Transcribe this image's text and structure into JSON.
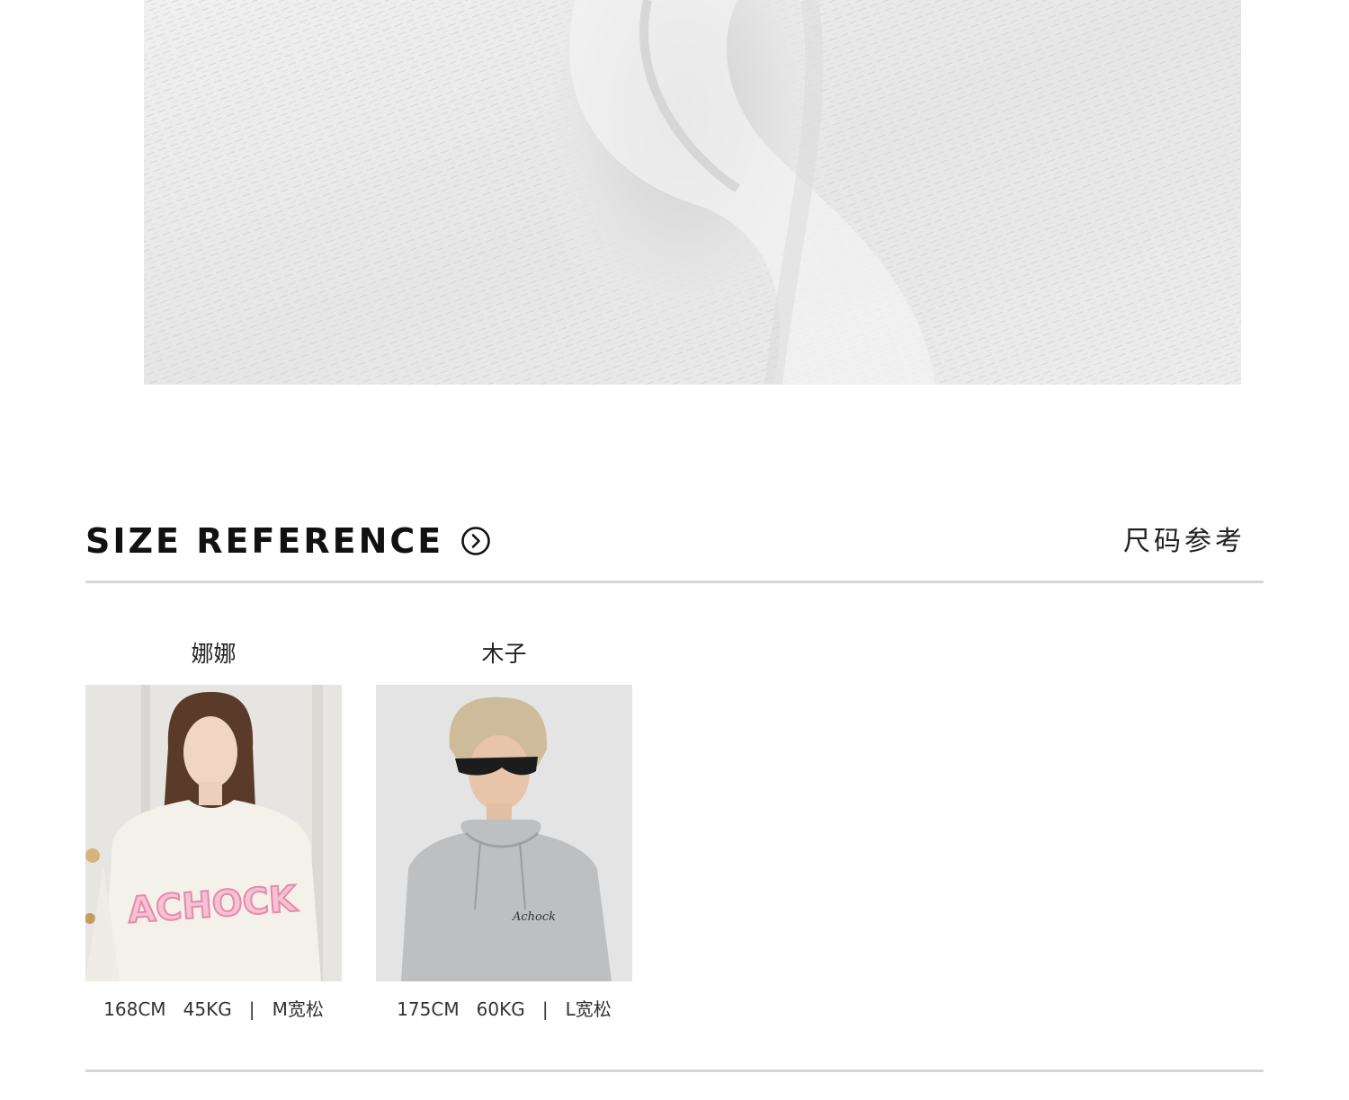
{
  "fabric_image": {
    "icon": "fabric-closeup-image"
  },
  "size_reference": {
    "title": "SIZE REFERENCE",
    "title_cn": "尺码参考",
    "arrow_icon": "circle-chevron-right-icon"
  },
  "models": [
    {
      "name": "娜娜",
      "height": "168CM",
      "weight": "45KG",
      "separator": "|",
      "size": "M宽松",
      "photo": "model-photo-female-sweater",
      "garment_print": "ACHOCK",
      "accent_color": "#f2a4c0"
    },
    {
      "name": "木子",
      "height": "175CM",
      "weight": "60KG",
      "separator": "|",
      "size": "L宽松",
      "photo": "model-photo-male-hoodie",
      "garment_print": "Achock",
      "accent_color": "#b3b5b7"
    }
  ]
}
